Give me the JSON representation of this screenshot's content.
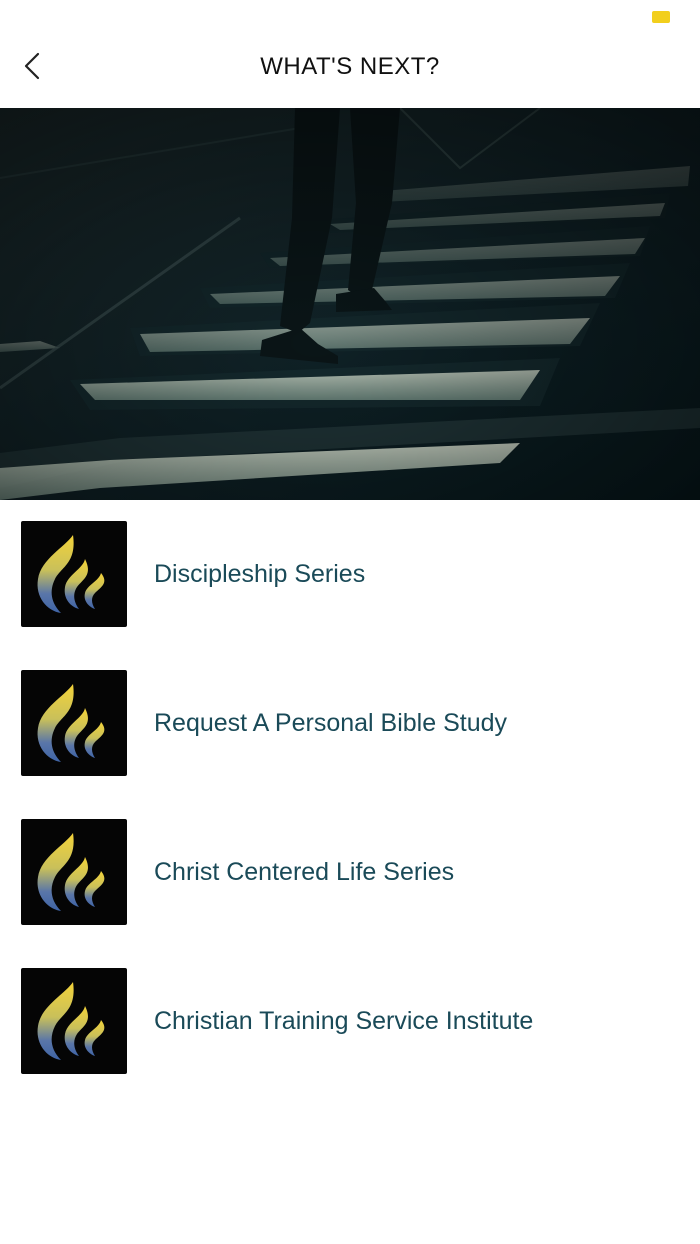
{
  "status_bar": {
    "battery_color": "#f2cf1d"
  },
  "nav": {
    "title": "WHAT'S NEXT?",
    "back_icon": "chevron-left-icon"
  },
  "hero": {
    "description_icon": "stairs-walking-image"
  },
  "colors": {
    "label_text": "#1a4a58",
    "flame_top": "#f3d33a",
    "flame_bottom": "#3f64a6",
    "thumb_bg": "#050505"
  },
  "items": [
    {
      "label": "Discipleship Series",
      "icon": "flame-logo-icon"
    },
    {
      "label": "Request A Personal Bible Study",
      "icon": "flame-logo-icon"
    },
    {
      "label": "Christ Centered Life Series",
      "icon": "flame-logo-icon"
    },
    {
      "label": "Christian Training Service Institute",
      "icon": "flame-logo-icon"
    }
  ]
}
